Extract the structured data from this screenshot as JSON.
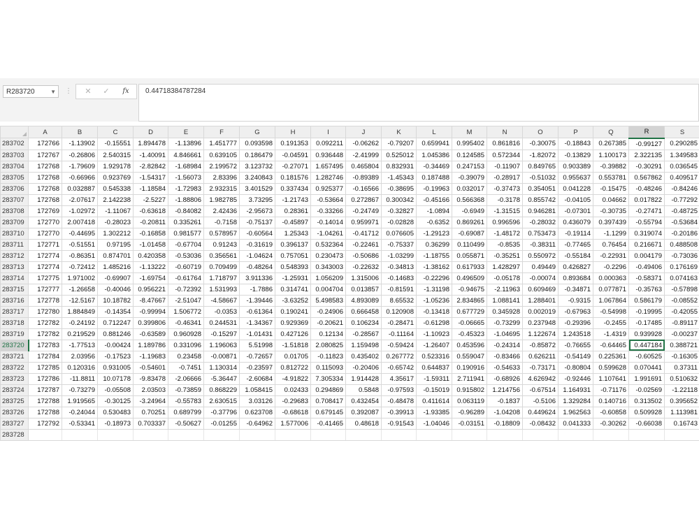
{
  "name_box": "R283720",
  "formula": "0.44718384787284",
  "buttons": {
    "cancel": "✕",
    "enter": "✓",
    "fx": "fx"
  },
  "columns": [
    "A",
    "B",
    "C",
    "D",
    "E",
    "F",
    "G",
    "H",
    "I",
    "J",
    "K",
    "L",
    "M",
    "N",
    "O",
    "P",
    "Q",
    "R",
    "S"
  ],
  "selected_column": "R",
  "selected_row": "283720",
  "rows": [
    {
      "row": "283702",
      "cells": [
        "172766",
        "-1.13902",
        "-0.15551",
        "1.894478",
        "-1.13896",
        "1.451777",
        "0.093598",
        "0.191353",
        "0.092211",
        "-0.06262",
        "-0.79207",
        "0.659941",
        "0.995402",
        "0.861816",
        "-0.30075",
        "-0.18843",
        "0.267385",
        "-0.99127",
        "0.290285"
      ]
    },
    {
      "row": "283703",
      "cells": [
        "172767",
        "-0.26806",
        "2.540315",
        "-1.40091",
        "4.846661",
        "0.639105",
        "0.186479",
        "-0.04591",
        "0.936448",
        "-2.41999",
        "0.525012",
        "1.045386",
        "0.124585",
        "0.572344",
        "-1.82072",
        "-0.13829",
        "1.100173",
        "2.322135",
        "1.349583"
      ]
    },
    {
      "row": "283704",
      "cells": [
        "172768",
        "-1.79609",
        "1.929178",
        "-2.82842",
        "-1.68984",
        "2.199572",
        "3.123732",
        "-0.27071",
        "1.657495",
        "0.465804",
        "0.832931",
        "-0.34469",
        "0.247153",
        "-0.11907",
        "0.849765",
        "0.903389",
        "-0.39882",
        "-0.30291",
        "0.036545"
      ]
    },
    {
      "row": "283705",
      "cells": [
        "172768",
        "-0.66966",
        "0.923769",
        "-1.54317",
        "-1.56073",
        "2.83396",
        "3.240843",
        "0.181576",
        "1.282746",
        "-0.89389",
        "-1.45343",
        "0.187488",
        "-0.39079",
        "-0.28917",
        "-0.51032",
        "0.955637",
        "0.553781",
        "0.567862",
        "0.409517"
      ]
    },
    {
      "row": "283706",
      "cells": [
        "172768",
        "0.032887",
        "0.545338",
        "-1.18584",
        "-1.72983",
        "2.932315",
        "3.401529",
        "0.337434",
        "0.925377",
        "-0.16566",
        "-0.38695",
        "-0.19963",
        "0.032017",
        "-0.37473",
        "0.354051",
        "0.041228",
        "-0.15475",
        "-0.48246",
        "-0.84246"
      ]
    },
    {
      "row": "283707",
      "cells": [
        "172768",
        "-2.07617",
        "2.142238",
        "-2.5227",
        "-1.88806",
        "1.982785",
        "3.73295",
        "-1.21743",
        "-0.53664",
        "0.272867",
        "0.300342",
        "-0.45166",
        "0.566368",
        "-0.3178",
        "0.855742",
        "-0.04105",
        "0.04662",
        "0.017822",
        "-0.77292"
      ]
    },
    {
      "row": "283708",
      "cells": [
        "172769",
        "-1.02972",
        "-1.11067",
        "-0.63618",
        "-0.84082",
        "2.42436",
        "-2.95673",
        "0.28361",
        "-0.33266",
        "-0.24749",
        "-0.32827",
        "-1.0894",
        "-0.6949",
        "-1.31515",
        "0.946281",
        "-0.07301",
        "-0.30735",
        "-0.27471",
        "-0.48725"
      ]
    },
    {
      "row": "283709",
      "cells": [
        "172770",
        "2.007418",
        "-0.28023",
        "-0.20811",
        "0.335261",
        "-0.7158",
        "-0.75137",
        "-0.45897",
        "-0.14014",
        "0.959971",
        "-0.02828",
        "-0.6352",
        "0.869261",
        "0.996596",
        "-0.28032",
        "0.436079",
        "0.397439",
        "-0.55794",
        "-0.53684"
      ]
    },
    {
      "row": "283710",
      "cells": [
        "172770",
        "-0.44695",
        "1.302212",
        "-0.16858",
        "0.981577",
        "0.578957",
        "-0.60564",
        "1.25343",
        "-1.04261",
        "-0.41712",
        "0.076605",
        "-1.29123",
        "-0.69087",
        "-1.48172",
        "0.753473",
        "-0.19114",
        "-1.1299",
        "0.319074",
        "-0.20186"
      ]
    },
    {
      "row": "283711",
      "cells": [
        "172771",
        "-0.51551",
        "0.97195",
        "-1.01458",
        "-0.67704",
        "0.91243",
        "-0.31619",
        "0.396137",
        "0.532364",
        "-0.22461",
        "-0.75337",
        "0.36299",
        "0.110499",
        "-0.8535",
        "-0.38311",
        "-0.77465",
        "0.76454",
        "0.216671",
        "0.488508"
      ]
    },
    {
      "row": "283712",
      "cells": [
        "172774",
        "-0.86351",
        "0.874701",
        "0.420358",
        "-0.53036",
        "0.356561",
        "-1.04624",
        "0.757051",
        "0.230473",
        "-0.50686",
        "-1.03299",
        "-1.18755",
        "0.055871",
        "-0.35251",
        "0.550972",
        "-0.55184",
        "-0.22931",
        "0.004179",
        "-0.73036"
      ]
    },
    {
      "row": "283713",
      "cells": [
        "172774",
        "-0.72412",
        "1.485216",
        "-1.13222",
        "-0.60719",
        "0.709499",
        "-0.48264",
        "0.548393",
        "0.343003",
        "-0.22632",
        "-0.34813",
        "-1.38162",
        "0.617933",
        "1.428297",
        "0.49449",
        "0.426827",
        "-0.2296",
        "-0.49406",
        "0.176169"
      ]
    },
    {
      "row": "283714",
      "cells": [
        "172775",
        "1.971002",
        "-0.69907",
        "-1.69754",
        "-0.61764",
        "1.718797",
        "3.911336",
        "-1.25931",
        "1.056209",
        "1.315006",
        "-0.14683",
        "-0.22296",
        "0.496509",
        "-0.05178",
        "-0.00074",
        "0.893684",
        "0.000363",
        "-0.58371",
        "0.074163"
      ]
    },
    {
      "row": "283715",
      "cells": [
        "172777",
        "-1.26658",
        "-0.40046",
        "0.956221",
        "-0.72392",
        "1.531993",
        "-1.7886",
        "0.314741",
        "0.004704",
        "0.013857",
        "-0.81591",
        "-1.31198",
        "-0.94675",
        "-2.11963",
        "0.609469",
        "-0.34871",
        "0.077871",
        "-0.35763",
        "-0.57898"
      ]
    },
    {
      "row": "283716",
      "cells": [
        "172778",
        "-12.5167",
        "10.18782",
        "-8.47667",
        "-2.51047",
        "-4.58667",
        "-1.39446",
        "-3.63252",
        "5.498583",
        "4.893089",
        "8.65532",
        "-1.05236",
        "2.834865",
        "1.088141",
        "1.288401",
        "-0.9315",
        "1.067864",
        "0.586179",
        "-0.08552"
      ]
    },
    {
      "row": "283717",
      "cells": [
        "172780",
        "1.884849",
        "-0.14354",
        "-0.99994",
        "1.506772",
        "-0.0353",
        "-0.61364",
        "0.190241",
        "-0.24906",
        "0.666458",
        "0.120908",
        "-0.13418",
        "0.677729",
        "0.345928",
        "0.002019",
        "-0.67963",
        "-0.54998",
        "-0.19995",
        "-0.42055"
      ]
    },
    {
      "row": "283718",
      "cells": [
        "172782",
        "-0.24192",
        "0.712247",
        "0.399806",
        "-0.46341",
        "0.244531",
        "-1.34367",
        "0.929369",
        "-0.20621",
        "0.106234",
        "-0.28471",
        "-0.61298",
        "-0.06665",
        "-0.73299",
        "0.237948",
        "-0.29396",
        "-0.2455",
        "-0.17485",
        "-0.89117"
      ]
    },
    {
      "row": "283719",
      "cells": [
        "172782",
        "0.219529",
        "0.881246",
        "-0.63589",
        "0.960928",
        "-0.15297",
        "-1.01431",
        "0.427126",
        "0.12134",
        "-0.28567",
        "-0.11164",
        "-1.10923",
        "-0.45323",
        "-1.04695",
        "1.122674",
        "1.243518",
        "-1.4319",
        "0.939928",
        "-0.00237"
      ]
    },
    {
      "row": "283720",
      "cells": [
        "172783",
        "-1.77513",
        "-0.00424",
        "1.189786",
        "0.331096",
        "1.196063",
        "5.51998",
        "-1.51818",
        "2.080825",
        "1.159498",
        "-0.59424",
        "-1.26407",
        "0.453596",
        "-0.24314",
        "-0.85872",
        "-0.76655",
        "-0.64465",
        "0.447184",
        "0.388721"
      ]
    },
    {
      "row": "283721",
      "cells": [
        "172784",
        "2.03956",
        "-0.17523",
        "-1.19683",
        "0.23458",
        "-0.00871",
        "-0.72657",
        "0.01705",
        "-0.11823",
        "0.435402",
        "0.267772",
        "0.523316",
        "0.559047",
        "-0.83466",
        "0.626211",
        "-0.54149",
        "0.225361",
        "-0.60525",
        "-0.16305"
      ]
    },
    {
      "row": "283722",
      "cells": [
        "172785",
        "0.120316",
        "0.931005",
        "-0.54601",
        "-0.7451",
        "1.130314",
        "-0.23597",
        "0.812722",
        "0.115093",
        "-0.20406",
        "-0.65742",
        "0.644837",
        "0.190916",
        "-0.54633",
        "-0.73171",
        "-0.80804",
        "0.599628",
        "0.070441",
        "0.37311"
      ]
    },
    {
      "row": "283723",
      "cells": [
        "172786",
        "-11.8811",
        "10.07178",
        "-9.83478",
        "-2.06666",
        "-5.36447",
        "-2.60684",
        "-4.91822",
        "7.305334",
        "1.914428",
        "4.35617",
        "-1.59311",
        "2.711941",
        "-0.68926",
        "4.626942",
        "-0.92446",
        "1.107641",
        "1.991691",
        "0.510632"
      ]
    },
    {
      "row": "283724",
      "cells": [
        "172787",
        "-0.73279",
        "-0.05508",
        "2.03503",
        "-0.73859",
        "0.868229",
        "1.058415",
        "0.02433",
        "0.294869",
        "0.5848",
        "-0.97593",
        "-0.15019",
        "0.915802",
        "1.214756",
        "-0.67514",
        "1.164931",
        "-0.71176",
        "-0.02569",
        "-1.22118"
      ]
    },
    {
      "row": "283725",
      "cells": [
        "172788",
        "1.919565",
        "-0.30125",
        "-3.24964",
        "-0.55783",
        "2.630515",
        "3.03126",
        "-0.29683",
        "0.708417",
        "0.432454",
        "-0.48478",
        "0.411614",
        "0.063119",
        "-0.1837",
        "-0.5106",
        "1.329284",
        "0.140716",
        "0.313502",
        "0.395652"
      ]
    },
    {
      "row": "283726",
      "cells": [
        "172788",
        "-0.24044",
        "0.530483",
        "0.70251",
        "0.689799",
        "-0.37796",
        "0.623708",
        "-0.68618",
        "0.679145",
        "0.392087",
        "-0.39913",
        "-1.93385",
        "-0.96289",
        "-1.04208",
        "0.449624",
        "1.962563",
        "-0.60858",
        "0.509928",
        "1.113981"
      ]
    },
    {
      "row": "283727",
      "cells": [
        "172792",
        "-0.53341",
        "-0.18973",
        "0.703337",
        "-0.50627",
        "-0.01255",
        "-0.64962",
        "1.577006",
        "-0.41465",
        "0.48618",
        "-0.91543",
        "-1.04046",
        "-0.03151",
        "-0.18809",
        "-0.08432",
        "0.041333",
        "-0.30262",
        "-0.66038",
        "0.16743"
      ]
    },
    {
      "row": "283728",
      "cells": [
        "",
        "",
        "",
        "",
        "",
        "",
        "",
        "",
        "",
        "",
        "",
        "",
        "",
        "",
        "",
        "",
        "",
        "",
        ""
      ]
    }
  ]
}
